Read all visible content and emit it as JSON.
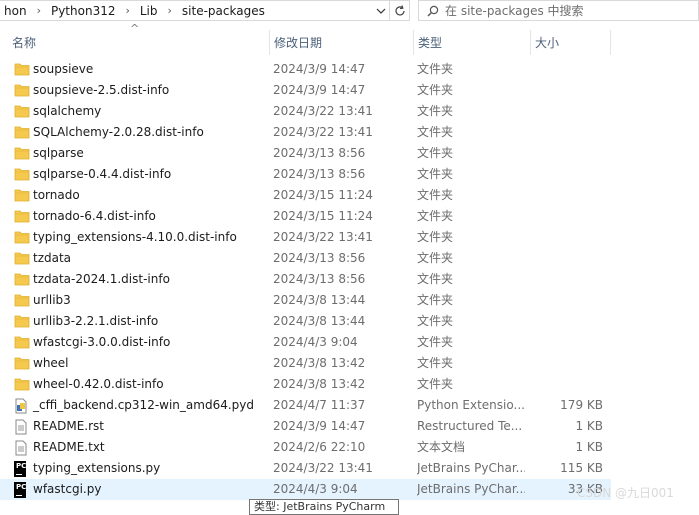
{
  "address": {
    "crumbs": [
      "hon",
      "Python312",
      "Lib",
      "site-packages"
    ]
  },
  "search": {
    "placeholder": "在 site-packages 中搜索"
  },
  "columns": {
    "name": "名称",
    "date": "修改日期",
    "type": "类型",
    "size": "大小"
  },
  "rows": [
    {
      "name": "soupsieve",
      "date": "2024/3/9 14:47",
      "type": "文件夹",
      "size": "",
      "icon": "folder-icon"
    },
    {
      "name": "soupsieve-2.5.dist-info",
      "date": "2024/3/9 14:47",
      "type": "文件夹",
      "size": "",
      "icon": "folder-icon"
    },
    {
      "name": "sqlalchemy",
      "date": "2024/3/22 13:41",
      "type": "文件夹",
      "size": "",
      "icon": "folder-icon"
    },
    {
      "name": "SQLAlchemy-2.0.28.dist-info",
      "date": "2024/3/22 13:41",
      "type": "文件夹",
      "size": "",
      "icon": "folder-icon"
    },
    {
      "name": "sqlparse",
      "date": "2024/3/13 8:56",
      "type": "文件夹",
      "size": "",
      "icon": "folder-icon"
    },
    {
      "name": "sqlparse-0.4.4.dist-info",
      "date": "2024/3/13 8:56",
      "type": "文件夹",
      "size": "",
      "icon": "folder-icon"
    },
    {
      "name": "tornado",
      "date": "2024/3/15 11:24",
      "type": "文件夹",
      "size": "",
      "icon": "folder-icon"
    },
    {
      "name": "tornado-6.4.dist-info",
      "date": "2024/3/15 11:24",
      "type": "文件夹",
      "size": "",
      "icon": "folder-icon"
    },
    {
      "name": "typing_extensions-4.10.0.dist-info",
      "date": "2024/3/22 13:41",
      "type": "文件夹",
      "size": "",
      "icon": "folder-icon"
    },
    {
      "name": "tzdata",
      "date": "2024/3/13 8:56",
      "type": "文件夹",
      "size": "",
      "icon": "folder-icon"
    },
    {
      "name": "tzdata-2024.1.dist-info",
      "date": "2024/3/13 8:56",
      "type": "文件夹",
      "size": "",
      "icon": "folder-icon"
    },
    {
      "name": "urllib3",
      "date": "2024/3/8 13:44",
      "type": "文件夹",
      "size": "",
      "icon": "folder-icon"
    },
    {
      "name": "urllib3-2.2.1.dist-info",
      "date": "2024/3/8 13:44",
      "type": "文件夹",
      "size": "",
      "icon": "folder-icon"
    },
    {
      "name": "wfastcgi-3.0.0.dist-info",
      "date": "2024/4/3 9:04",
      "type": "文件夹",
      "size": "",
      "icon": "folder-icon"
    },
    {
      "name": "wheel",
      "date": "2024/3/8 13:42",
      "type": "文件夹",
      "size": "",
      "icon": "folder-icon"
    },
    {
      "name": "wheel-0.42.0.dist-info",
      "date": "2024/3/8 13:42",
      "type": "文件夹",
      "size": "",
      "icon": "folder-icon"
    },
    {
      "name": "_cffi_backend.cp312-win_amd64.pyd",
      "date": "2024/4/7 11:37",
      "type": "Python Extensio...",
      "size": "179 KB",
      "icon": "python-extension-icon"
    },
    {
      "name": "README.rst",
      "date": "2024/3/9 14:47",
      "type": "Restructured Te...",
      "size": "1 KB",
      "icon": "text-file-icon"
    },
    {
      "name": "README.txt",
      "date": "2024/2/6 22:10",
      "type": "文本文档",
      "size": "1 KB",
      "icon": "text-file-icon"
    },
    {
      "name": "typing_extensions.py",
      "date": "2024/3/22 13:41",
      "type": "JetBrains PyChar...",
      "size": "115 KB",
      "icon": "pycharm-file-icon"
    },
    {
      "name": "wfastcgi.py",
      "date": "2024/4/3 9:04",
      "type": "JetBrains PyChar...",
      "size": "33 KB",
      "icon": "pycharm-file-icon"
    }
  ],
  "tooltip": {
    "text": "类型: JetBrains PyCharm"
  },
  "watermark": "CSDN @九日001",
  "colors": {
    "folder": "#f5c94d",
    "hover_row": "#e5f3ff",
    "header_text": "#4c607a"
  }
}
